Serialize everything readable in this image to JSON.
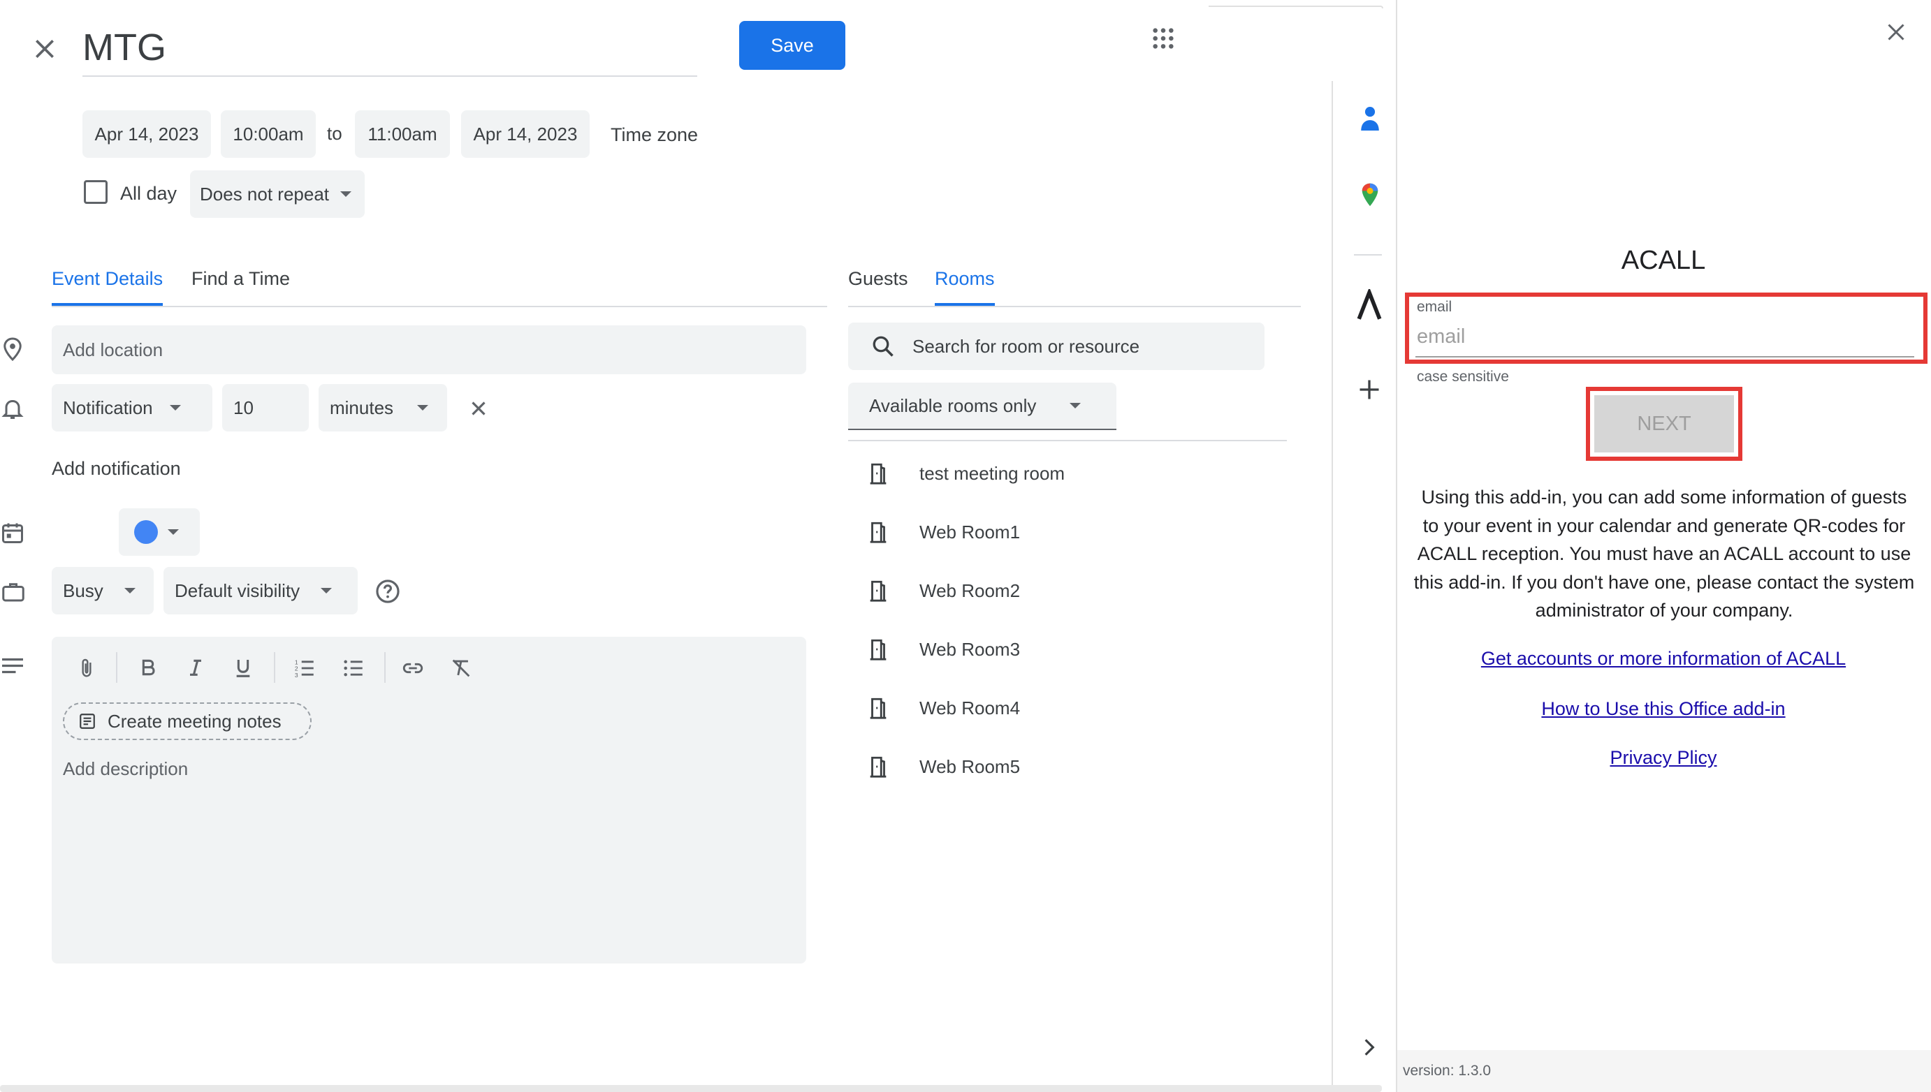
{
  "event": {
    "title": "MTG",
    "save_label": "Save",
    "start_date": "Apr 14, 2023",
    "start_time": "10:00am",
    "to_label": "to",
    "end_time": "11:00am",
    "end_date": "Apr 14, 2023",
    "timezone_label": "Time zone",
    "allday_label": "All day",
    "repeat_value": "Does not repeat"
  },
  "tabs": {
    "details": "Event Details",
    "find_time": "Find a Time",
    "guests": "Guests",
    "rooms": "Rooms"
  },
  "details": {
    "location_placeholder": "Add location",
    "notification_type": "Notification",
    "notification_value": "10",
    "notification_unit": "minutes",
    "add_notification": "Add notification",
    "status_value": "Busy",
    "visibility_value": "Default visibility",
    "meeting_notes_label": "Create meeting notes",
    "description_placeholder": "Add description",
    "event_color": "#4285f4"
  },
  "rooms": {
    "search_placeholder": "Search for room or resource",
    "filter_value": "Available rooms only",
    "items": [
      {
        "name": "test meeting room"
      },
      {
        "name": "Web Room1"
      },
      {
        "name": "Web Room2"
      },
      {
        "name": "Web Room3"
      },
      {
        "name": "Web Room4"
      },
      {
        "name": "Web Room5"
      }
    ]
  },
  "addin": {
    "title": "ACALL",
    "email_label": "email",
    "email_placeholder": "email",
    "email_helper": "case sensitive",
    "next_label": "NEXT",
    "description": "Using this add-in, you can add some information of guests to your event in your calendar and generate QR-codes for ACALL reception. You must have an ACALL account to use this add-in. If you don't have one, please contact the system administrator of your company.",
    "link_accounts": "Get accounts or more information of ACALL",
    "link_howto": "How to Use this Office add-in",
    "link_privacy": "Privacy Plicy",
    "version": "version: 1.3.0",
    "highlight_color": "#e53935"
  },
  "colors": {
    "accent": "#1a73e8",
    "field_bg": "#f1f3f4"
  }
}
